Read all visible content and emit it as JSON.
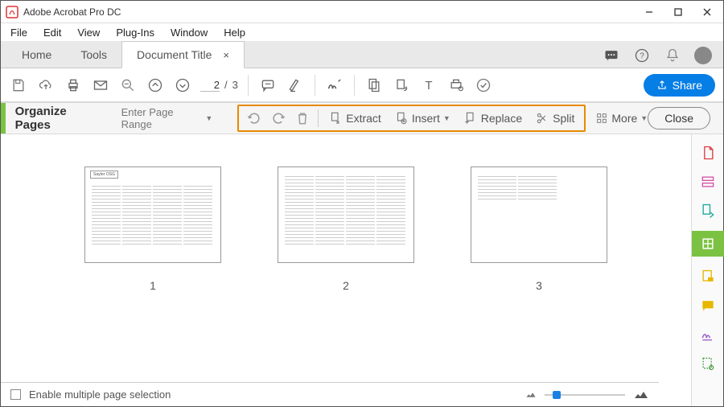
{
  "titlebar": {
    "app_name": "Adobe Acrobat Pro DC"
  },
  "menu": [
    "File",
    "Edit",
    "View",
    "Plug-Ins",
    "Window",
    "Help"
  ],
  "tabs": {
    "home": "Home",
    "tools": "Tools",
    "doc": "Document Title"
  },
  "toolbar": {
    "page_current": "2",
    "page_total": "3",
    "share_label": "Share"
  },
  "organize": {
    "title": "Organize Pages",
    "range_placeholder": "Enter Page Range",
    "extract": "Extract",
    "insert": "Insert",
    "replace": "Replace",
    "split": "Split",
    "more": "More",
    "close": "Close"
  },
  "pages": [
    {
      "number": "1",
      "header": "Sayter  OSG"
    },
    {
      "number": "2",
      "header": ""
    },
    {
      "number": "3",
      "header": ""
    }
  ],
  "footer": {
    "checkbox_label": "Enable multiple page selection"
  }
}
